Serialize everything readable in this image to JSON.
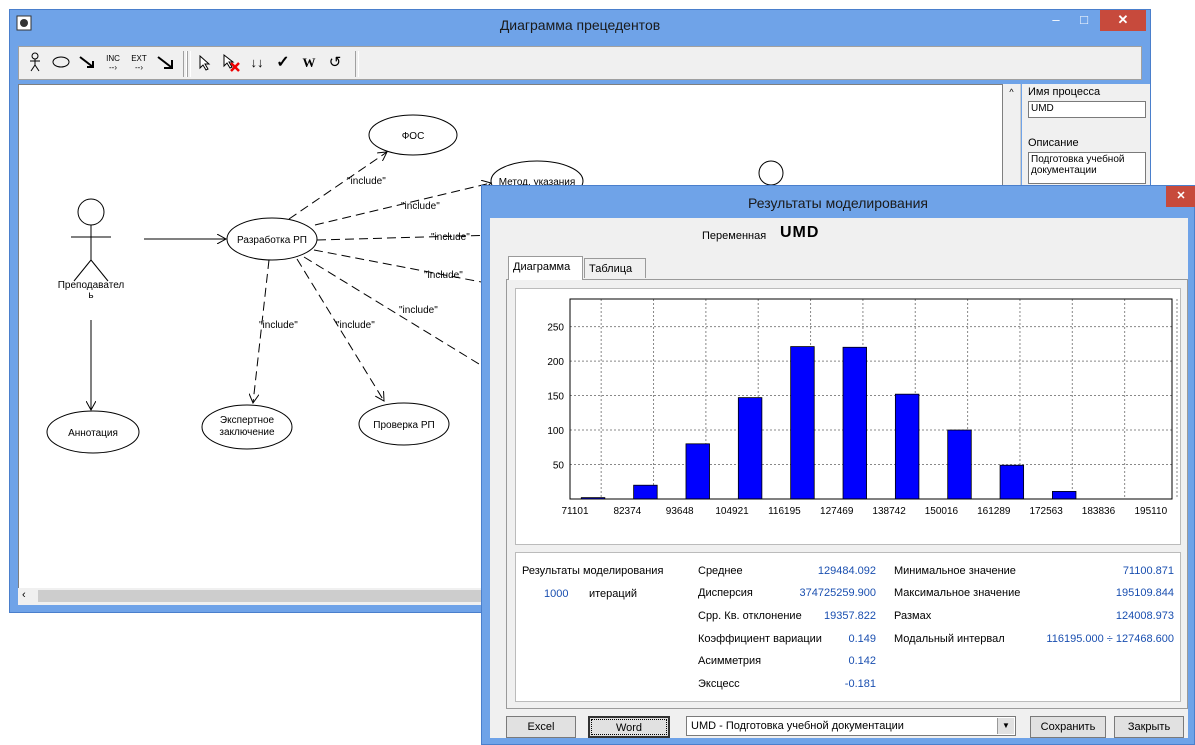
{
  "diagram_window": {
    "title": "Диаграмма прецедентов",
    "controls": {
      "minimize": "–",
      "maximize": "□",
      "close": "✕"
    },
    "toolbar": {
      "actor_icon": "actor-icon",
      "usecase_icon": "ellipse-icon",
      "association_icon": "arrow-icon",
      "inc_label": "INC",
      "ext_label": "EXT",
      "generalization_icon": "generalization-arrow-icon",
      "select_icon": "pointer-icon",
      "delete_icon": "delete-pointer-icon",
      "sort_icon": "sort-icon",
      "check_icon": "check-icon",
      "word_icon": "W",
      "undo_icon": "undo-icon"
    },
    "diagram": {
      "actors": [
        {
          "label_line1": "Преподавател",
          "label_line2": "ь"
        }
      ],
      "usecases": [
        "ФОС",
        "Метод. указания",
        "Разработка РП",
        "Аннотация",
        "Экспертное",
        "заключение",
        "Проверка РП"
      ],
      "include_label": "\"include\""
    },
    "right_panel": {
      "process_name_label": "Имя процесса",
      "process_name_value": "UMD",
      "description_label": "Описание",
      "description_value": "Подготовка учебной документации"
    }
  },
  "results_window": {
    "title": "Результаты моделирования",
    "close": "✕",
    "variable_label": "Переменная",
    "variable_name": "UMD",
    "tabs": [
      {
        "label": "Диаграмма",
        "active": true
      },
      {
        "label": "Таблица",
        "active": false
      }
    ],
    "stats": {
      "header": "Результаты моделирования",
      "iterations_value": "1000",
      "iterations_label": "итераций",
      "left": [
        {
          "label": "Среднее",
          "value": "129484.092"
        },
        {
          "label": "Дисперсия",
          "value": "374725259.900"
        },
        {
          "label": "Срр. Кв. отклонение",
          "value": "19357.822"
        },
        {
          "label": "Коэффициент вариации",
          "value": "0.149"
        },
        {
          "label": "Асимметрия",
          "value": "0.142"
        },
        {
          "label": "Эксцесс",
          "value": "-0.181"
        }
      ],
      "right": [
        {
          "label": "Минимальное значение",
          "value": "71100.871"
        },
        {
          "label": "Максимальное значение",
          "value": "195109.844"
        },
        {
          "label": "Размах",
          "value": "124008.973"
        },
        {
          "label": "Модальный интервал",
          "value": "116195.000 ÷ 127468.600"
        }
      ]
    },
    "buttons": {
      "excel": "Excel",
      "word": "Word",
      "save": "Сохранить",
      "close": "Закрыть"
    },
    "combo_value": "UMD - Подготовка учебной документации",
    "colors": {
      "bar": "#0000ff",
      "accent": "#1a4fb0"
    }
  },
  "chart_data": {
    "type": "bar",
    "categories": [
      "71101",
      "82374",
      "93648",
      "104921",
      "116195",
      "127469",
      "138742",
      "150016",
      "161289",
      "172563",
      "183836",
      "195110"
    ],
    "values": [
      2,
      20,
      80,
      147,
      221,
      220,
      152,
      100,
      49,
      11,
      0,
      0
    ],
    "ylim": [
      0,
      290
    ],
    "yticks": [
      50,
      100,
      150,
      200,
      250
    ],
    "grid": true
  }
}
